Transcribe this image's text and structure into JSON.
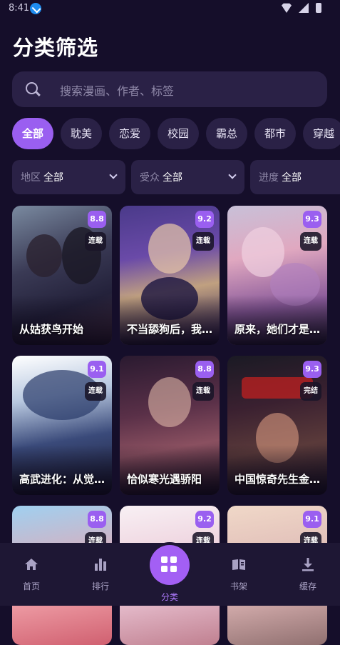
{
  "status_bar": {
    "time": "8:41"
  },
  "page_title": "分类筛选",
  "search": {
    "placeholder": "搜索漫画、作者、标签"
  },
  "genre_chips": [
    {
      "label": "全部",
      "active": true
    },
    {
      "label": "耽美",
      "active": false
    },
    {
      "label": "恋爱",
      "active": false
    },
    {
      "label": "校园",
      "active": false
    },
    {
      "label": "霸总",
      "active": false
    },
    {
      "label": "都市",
      "active": false
    },
    {
      "label": "穿越",
      "active": false
    }
  ],
  "filters": [
    {
      "key": "地区",
      "value": "全部"
    },
    {
      "key": "受众",
      "value": "全部"
    },
    {
      "key": "进度",
      "value": "全部"
    }
  ],
  "comics": [
    {
      "title": "从姑获鸟开始",
      "score": "8.8",
      "status": "连载"
    },
    {
      "title": "不当舔狗后，我成了亿万神豪",
      "score": "9.2",
      "status": "连载"
    },
    {
      "title": "原来，她们才是主角",
      "score": "9.3",
      "status": "连载"
    },
    {
      "title": "高武进化：从觉醒开始",
      "score": "9.1",
      "status": "连载"
    },
    {
      "title": "恰似寒光遇骄阳",
      "score": "8.8",
      "status": "连载"
    },
    {
      "title": "中国惊奇先生金刚师",
      "score": "9.3",
      "status": "完结"
    },
    {
      "title": "",
      "score": "8.8",
      "status": "连载"
    },
    {
      "title": "",
      "score": "9.2",
      "status": "连载"
    },
    {
      "title": "",
      "score": "9.1",
      "status": "连载"
    }
  ],
  "bottom_nav": {
    "items": [
      {
        "label": "首页",
        "icon": "home-icon"
      },
      {
        "label": "排行",
        "icon": "ranking-icon"
      },
      {
        "label": "分类",
        "icon": "category-grid-icon",
        "active": true
      },
      {
        "label": "书架",
        "icon": "bookshelf-icon"
      },
      {
        "label": "缓存",
        "icon": "download-icon"
      }
    ]
  },
  "colors": {
    "background": "#150e2a",
    "accent": "#9a5ff0",
    "surface": "#2a2146"
  }
}
